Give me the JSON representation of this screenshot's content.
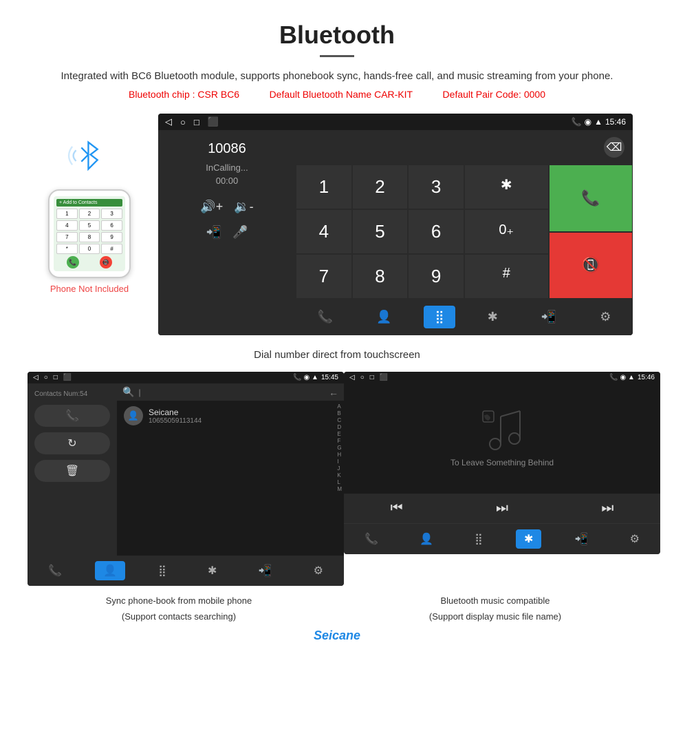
{
  "header": {
    "title": "Bluetooth",
    "description": "Integrated with BC6 Bluetooth module, supports phonebook sync, hands-free call, and music streaming from your phone.",
    "spec_chip": "Bluetooth chip : CSR BC6",
    "spec_name": "Default Bluetooth Name CAR-KIT",
    "spec_code": "Default Pair Code: 0000"
  },
  "main_dial": {
    "statusbar": {
      "time": "15:46",
      "left_icons": [
        "◁",
        "○",
        "□",
        "■▪"
      ]
    },
    "number": "10086",
    "status": "InCalling...",
    "call_time": "00:00",
    "vol_up": "🔊+",
    "vol_down": "🔉-",
    "transfer": "📲",
    "mute": "🎤",
    "keys": [
      "1",
      "2",
      "3",
      "*",
      "4",
      "5",
      "6",
      "0+",
      "7",
      "8",
      "9",
      "#"
    ],
    "call_btn": "📞",
    "end_btn": "📵",
    "nav_items": [
      "📞↗",
      "👤",
      "⣿",
      "✱",
      "📲",
      "⚙"
    ]
  },
  "main_caption": "Dial number direct from touchscreen",
  "phone_side": {
    "not_included": "Phone Not Included"
  },
  "contacts_screen": {
    "statusbar_time": "15:45",
    "contacts_num": "Contacts Num:54",
    "contact_name": "Seicane",
    "contact_number": "10655059113144",
    "alpha_list": [
      "A",
      "B",
      "C",
      "D",
      "E",
      "F",
      "G",
      "H",
      "I",
      "J",
      "K",
      "L",
      "M"
    ],
    "nav_items": [
      "📞↗",
      "👤",
      "⣿",
      "✱",
      "📲",
      "⚙"
    ]
  },
  "music_screen": {
    "statusbar_time": "15:46",
    "song_title": "To Leave Something Behind",
    "nav_items": [
      "📞↗",
      "👤",
      "⣿",
      "✱",
      "📲",
      "⚙"
    ]
  },
  "bottom_captions": {
    "left_main": "Sync phone-book from mobile phone",
    "left_sub": "(Support contacts searching)",
    "right_main": "Bluetooth music compatible",
    "right_sub": "(Support display music file name)"
  },
  "watermark": "Seicane"
}
